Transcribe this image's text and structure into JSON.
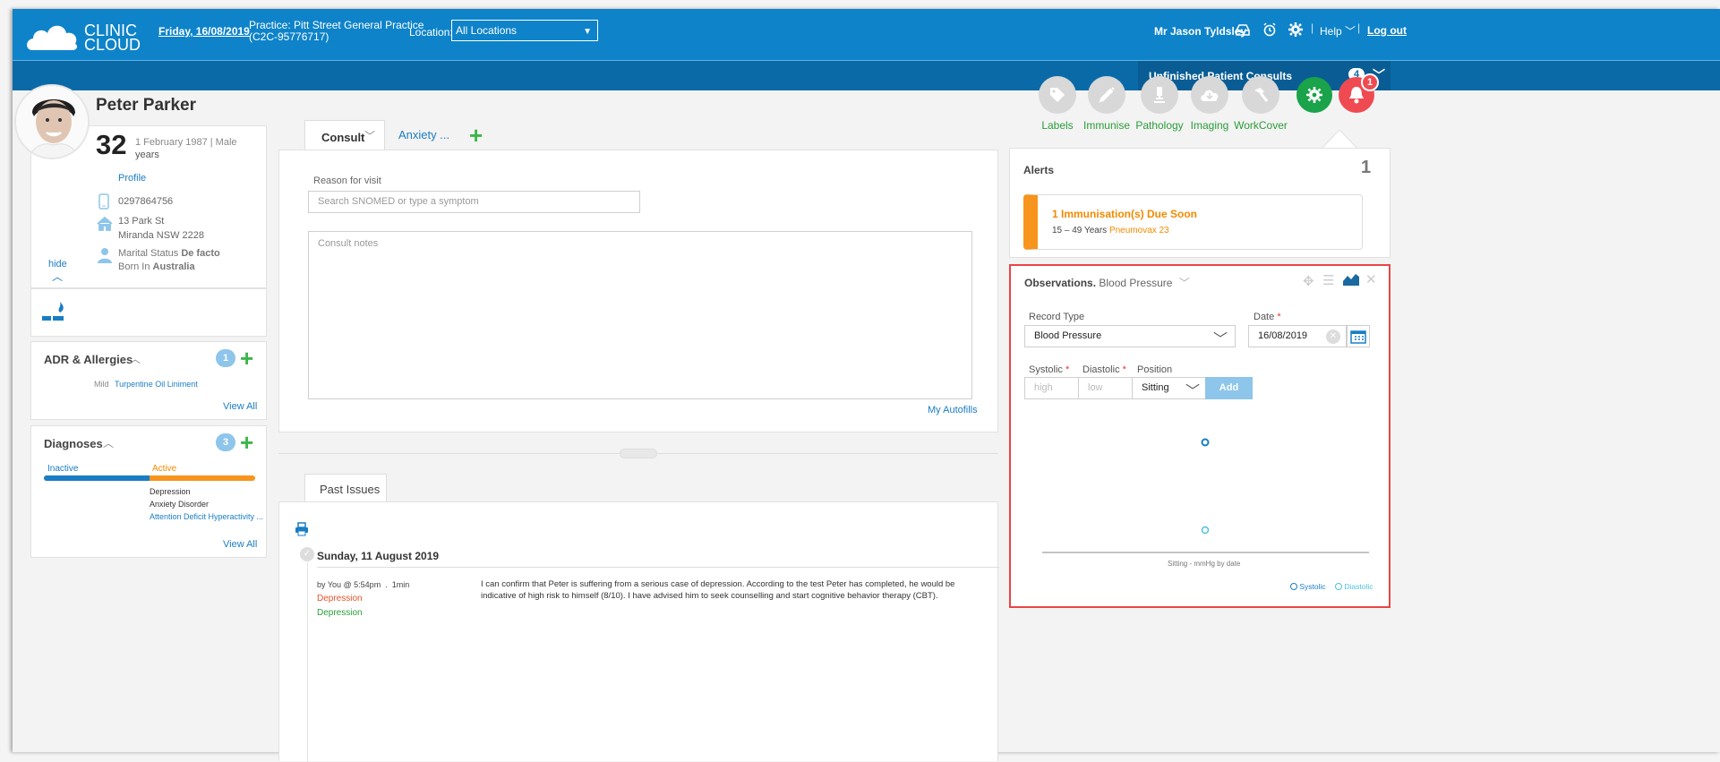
{
  "header": {
    "brand": "CLINIC TO CLOUD",
    "date": "Friday, 16/08/2019",
    "practice_line1": "Practice: Pitt Street General Practice",
    "practice_line2": "(C2C-95776717)",
    "location_label": "Location:",
    "location_value": "All Locations",
    "user": "Mr Jason Tyldsley",
    "help": "Help",
    "logout": "Log out"
  },
  "subbar": {
    "unfinished_label": "Unfinished Patient Consults",
    "unfinished_count": "4"
  },
  "patient": {
    "name": "Peter Parker",
    "age": "32",
    "age_unit": "years",
    "dob_sex": "1 February 1987 | Male",
    "profile": "Profile",
    "phone": "0297864756",
    "address1": "13 Park St",
    "address2": "Miranda NSW 2228",
    "marital_label": "Marital Status",
    "marital_value": "De facto",
    "born_label": "Born In",
    "born_value": "Australia",
    "hide": "hide"
  },
  "adr": {
    "title": "ADR & Allergies",
    "count": "1",
    "severity": "Mild",
    "item": "Turpentine Oil Liniment",
    "view_all": "View All"
  },
  "diagnoses": {
    "title": "Diagnoses",
    "count": "3",
    "inactive": "Inactive",
    "active": "Active",
    "items": [
      "Depression",
      "Anxiety Disorder",
      "Attention Deficit Hyperactivity ..."
    ],
    "view_all": "View All",
    "inactive_fraction": 0.5
  },
  "consult": {
    "tabs": [
      "Consult",
      "Anxiety ..."
    ],
    "reason_label": "Reason for visit",
    "reason_placeholder": "Search SNOMED or type a symptom",
    "notes_placeholder": "Consult notes",
    "autofills": "My Autofills"
  },
  "past": {
    "tab": "Past Issues",
    "date": "Sunday, 11 August 2019",
    "by": "by You @ 5:54pm  .  1min",
    "tag1": "Depression",
    "tag2": "Depression",
    "note": "I can confirm that Peter is suffering from a serious case of depression. According to the test Peter has completed, he would be indicative of high risk to himself (8/10). I have advised him to seek counselling and start cognitive behavior therapy (CBT)."
  },
  "tools": [
    {
      "label": "Labels",
      "icon": "tag-icon"
    },
    {
      "label": "Immunise",
      "icon": "syringe-icon"
    },
    {
      "label": "Pathology",
      "icon": "microscope-icon"
    },
    {
      "label": "Imaging",
      "icon": "cloud-icon"
    },
    {
      "label": "WorkCover",
      "icon": "hammer-icon"
    }
  ],
  "notif_count": "1",
  "alerts": {
    "title": "Alerts",
    "count": "1",
    "alert_title": "1 Immunisation(s) Due Soon",
    "alert_range": "15 – 49 Years",
    "alert_vaccine": "Pneumovax 23"
  },
  "observations": {
    "title": "Observations.",
    "subtitle": "Blood Pressure",
    "record_type_label": "Record Type",
    "record_type_value": "Blood Pressure",
    "date_label": "Date",
    "date_value": "16/08/2019",
    "systolic_label": "Systolic",
    "diastolic_label": "Diastolic",
    "position_label": "Position",
    "systolic_placeholder": "high",
    "diastolic_placeholder": "low",
    "position_value": "Sitting",
    "add": "Add",
    "chart_caption": "Sitting - mmHg by date",
    "legend_systolic": "Systolic",
    "legend_diastolic": "Diastolic"
  },
  "colors": {
    "topbar": "#0e83c9",
    "subbar": "#0a6aa8",
    "green": "#2a9d3a",
    "orange": "#f28a00",
    "red_alert": "#ef4a52"
  }
}
